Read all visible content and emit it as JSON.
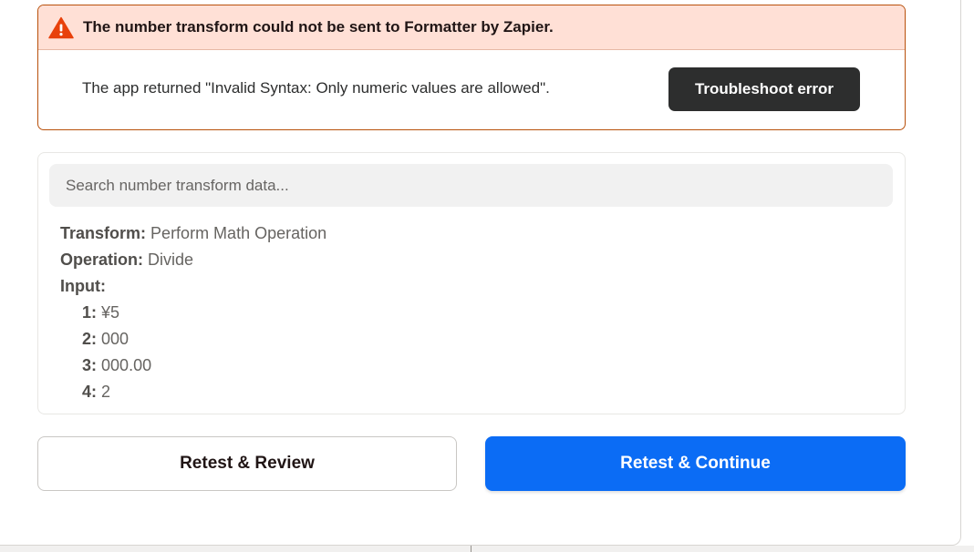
{
  "error": {
    "title": "The number transform could not be sent to Formatter by Zapier.",
    "message": "The app returned \"Invalid Syntax: Only numeric values are allowed\".",
    "troubleshoot_label": "Troubleshoot error",
    "icon": "warning-triangle-icon",
    "icon_color": "#e8410b"
  },
  "data_panel": {
    "search_placeholder": "Search number transform data...",
    "fields": [
      {
        "key": "Transform:",
        "value": "Perform Math Operation"
      },
      {
        "key": "Operation:",
        "value": "Divide"
      },
      {
        "key": "Input:",
        "value": ""
      }
    ],
    "inputs": [
      {
        "key": "1:",
        "value": "¥5"
      },
      {
        "key": "2:",
        "value": "000"
      },
      {
        "key": "3:",
        "value": "000.00"
      },
      {
        "key": "4:",
        "value": "2"
      }
    ]
  },
  "actions": {
    "retest_review_label": "Retest & Review",
    "retest_continue_label": "Retest & Continue",
    "primary_color": "#0b6cf5"
  }
}
